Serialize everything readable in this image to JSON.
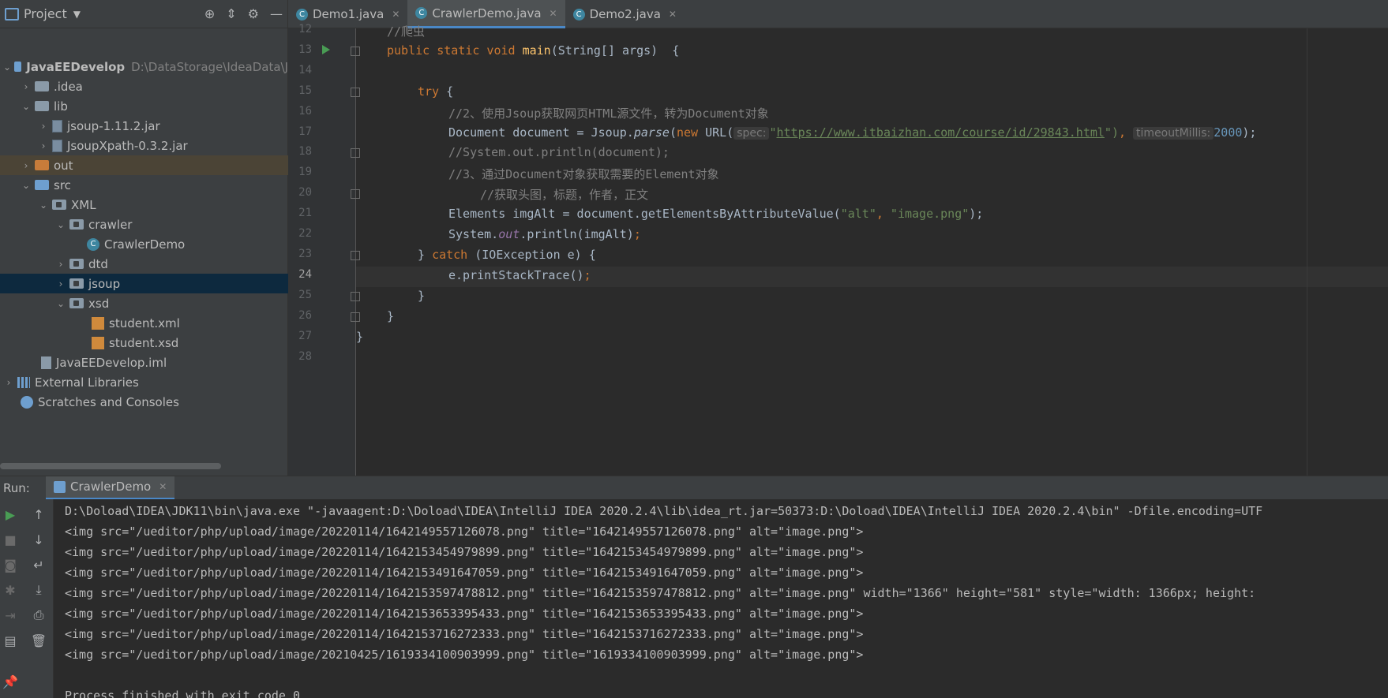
{
  "project": {
    "title": "Project",
    "tree": [
      {
        "label": "JavaEEDevelop",
        "path": "D:\\DataStorage\\IdeaData\\J"
      },
      {
        "label": ".idea"
      },
      {
        "label": "lib"
      },
      {
        "label": "jsoup-1.11.2.jar"
      },
      {
        "label": "JsoupXpath-0.3.2.jar"
      },
      {
        "label": "out"
      },
      {
        "label": "src"
      },
      {
        "label": "XML"
      },
      {
        "label": "crawler"
      },
      {
        "label": "CrawlerDemo"
      },
      {
        "label": "dtd"
      },
      {
        "label": "jsoup"
      },
      {
        "label": "xsd"
      },
      {
        "label": "student.xml"
      },
      {
        "label": "student.xsd"
      },
      {
        "label": "JavaEEDevelop.iml"
      },
      {
        "label": "External Libraries"
      },
      {
        "label": "Scratches and Consoles"
      }
    ]
  },
  "tabs": [
    {
      "label": "Demo1.java"
    },
    {
      "label": "CrawlerDemo.java"
    },
    {
      "label": "Demo2.java"
    }
  ],
  "editor": {
    "line_numbers": [
      "12",
      "13",
      "14",
      "15",
      "16",
      "17",
      "18",
      "19",
      "20",
      "21",
      "22",
      "23",
      "24",
      "25",
      "26",
      "27",
      "28"
    ],
    "current_line": "24",
    "lines": {
      "l12": "//爬虫",
      "l13_a": "public static void ",
      "l13_b": "main",
      "l13_c": "(String[] args)  {",
      "l15_a": "try",
      "l15_b": " {",
      "l16": "//2、使用Jsoup获取网页HTML源文件，转为Document对象",
      "l17_a": "Document document = Jsoup.",
      "l17_b": "parse",
      "l17_c": "(",
      "l17_d": "new",
      "l17_e": " URL(",
      "l17_hint1": "spec:",
      "l17_q1": "\"",
      "l17_url": "https://www.itbaizhan.com/course/id/29843.html",
      "l17_q2": "\")",
      "l17_f": ", ",
      "l17_hint2": "timeoutMillis:",
      "l17_num": "2000",
      "l17_g": ");",
      "l18": "//System.out.println(document);",
      "l19": "//3、通过Document对象获取需要的Element对象",
      "l20": "//获取头图，标题，作者，正文",
      "l21_a": "Elements imgAlt = document.getElementsByAttributeValue(",
      "l21_s1": "\"alt\"",
      "l21_b": ", ",
      "l21_s2": "\"image.png\"",
      "l21_c": ");",
      "l22_a": "System.",
      "l22_b": "out",
      "l22_c": ".println(imgAlt)",
      "l22_d": ";",
      "l23_a": "} ",
      "l23_b": "catch",
      "l23_c": " (IOException e) {",
      "l24_a": "e.printStackTrace()",
      "l24_b": ";",
      "l25": "}",
      "l26": "}",
      "l27": "}"
    }
  },
  "run": {
    "label": "Run:",
    "tab": "CrawlerDemo",
    "console": [
      "D:\\Doload\\IDEA\\JDK11\\bin\\java.exe \"-javaagent:D:\\Doload\\IDEA\\IntelliJ IDEA 2020.2.4\\lib\\idea_rt.jar=50373:D:\\Doload\\IDEA\\IntelliJ IDEA 2020.2.4\\bin\" -Dfile.encoding=UTF",
      "<img src=\"/ueditor/php/upload/image/20220114/1642149557126078.png\" title=\"1642149557126078.png\" alt=\"image.png\">",
      "<img src=\"/ueditor/php/upload/image/20220114/1642153454979899.png\" title=\"1642153454979899.png\" alt=\"image.png\">",
      "<img src=\"/ueditor/php/upload/image/20220114/1642153491647059.png\" title=\"1642153491647059.png\" alt=\"image.png\">",
      "<img src=\"/ueditor/php/upload/image/20220114/1642153597478812.png\" title=\"1642153597478812.png\" alt=\"image.png\" width=\"1366\" height=\"581\" style=\"width: 1366px; height:",
      "<img src=\"/ueditor/php/upload/image/20220114/1642153653395433.png\" title=\"1642153653395433.png\" alt=\"image.png\">",
      "<img src=\"/ueditor/php/upload/image/20220114/1642153716272333.png\" title=\"1642153716272333.png\" alt=\"image.png\">",
      "<img src=\"/ueditor/php/upload/image/20210425/1619334100903999.png\" title=\"1619334100903999.png\" alt=\"image.png\">",
      "",
      "Process finished with exit code 0"
    ]
  }
}
